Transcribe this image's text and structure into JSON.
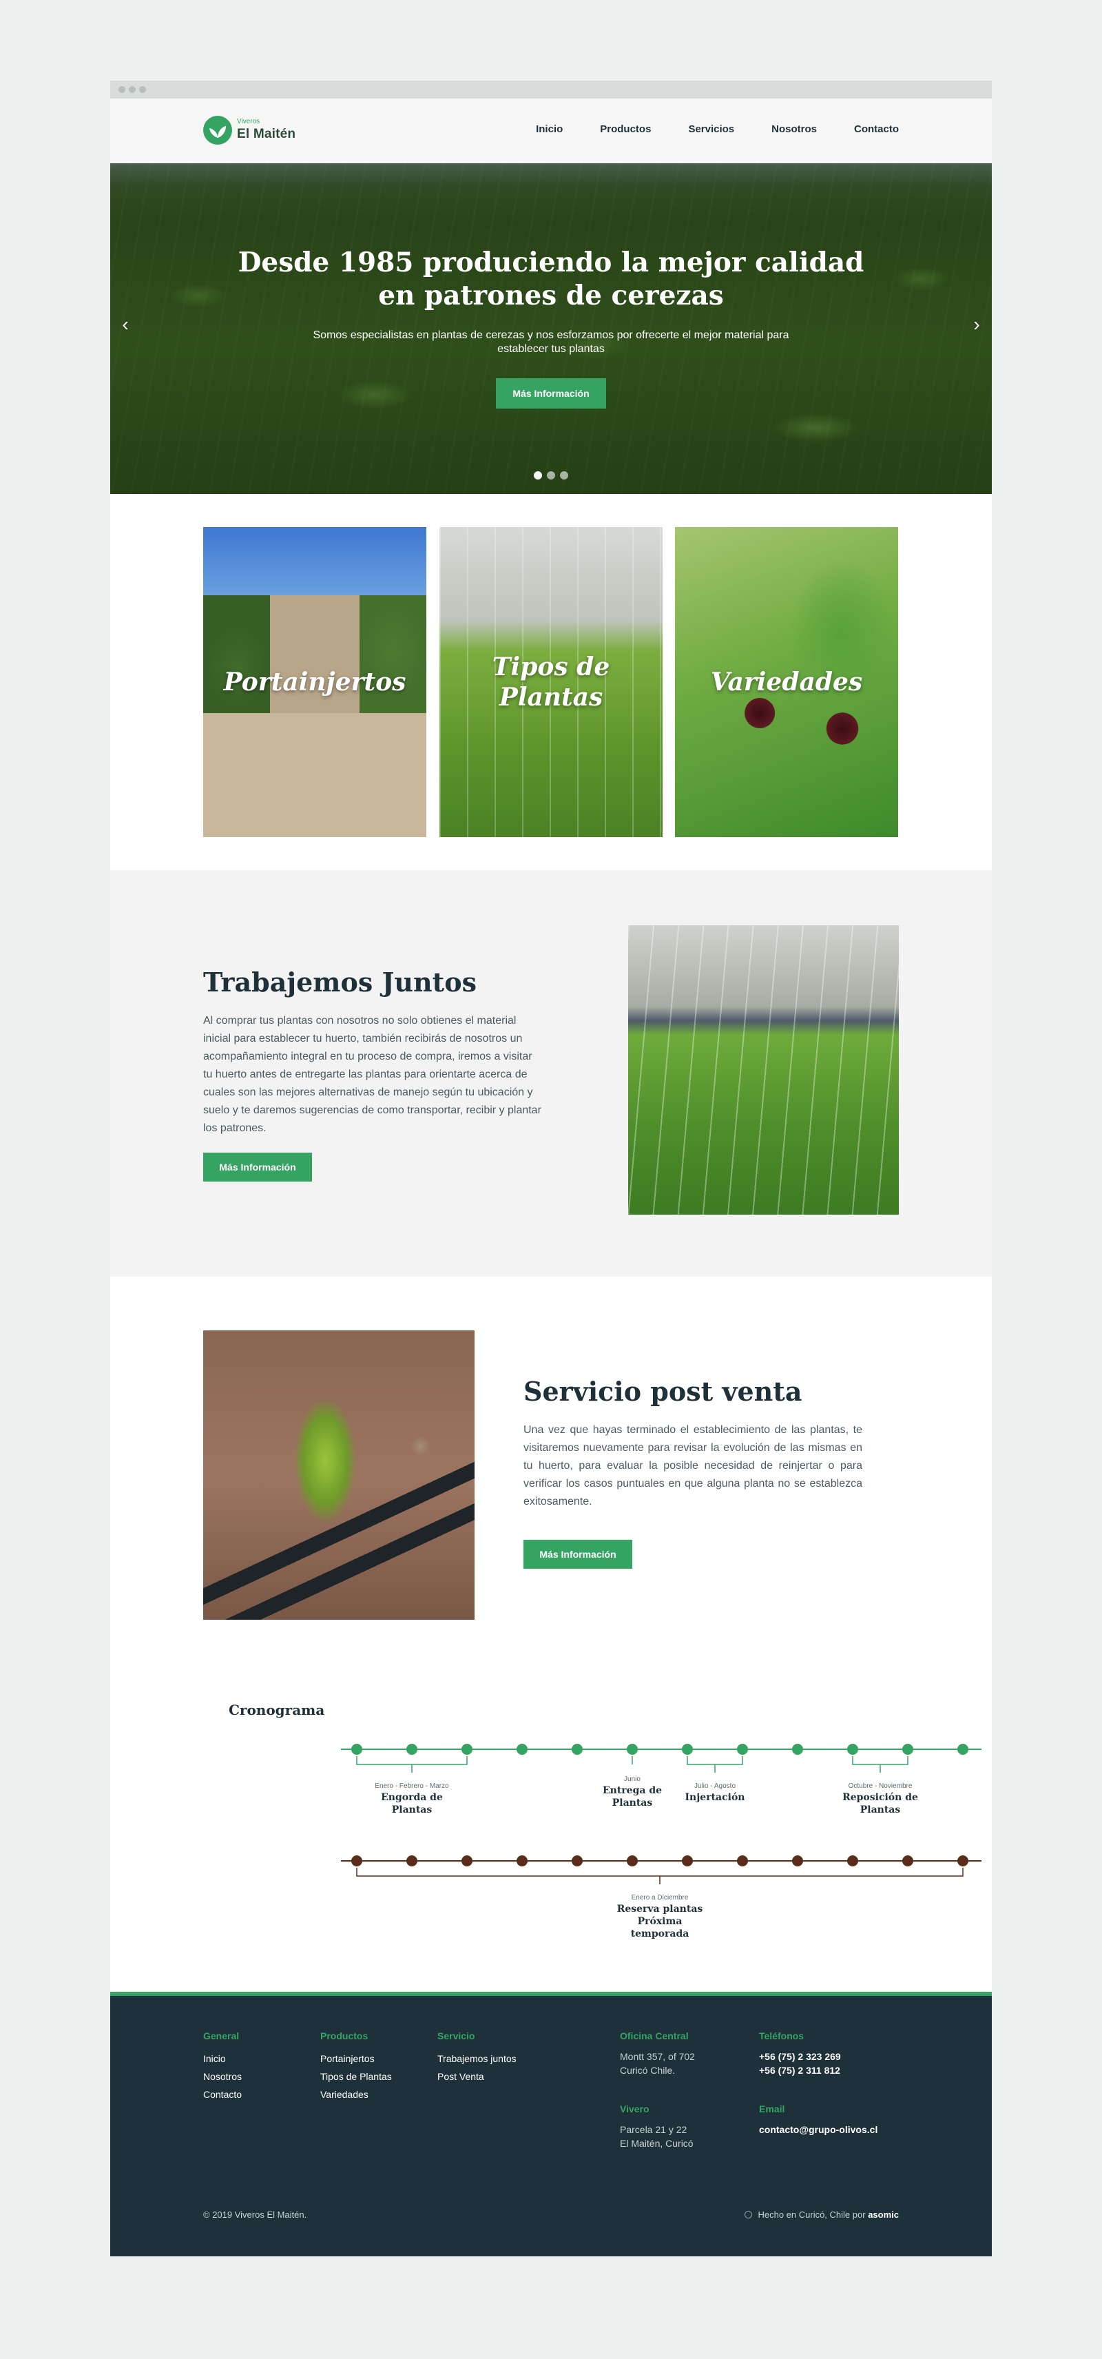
{
  "brand": {
    "small": "Viveros",
    "name": "El Maitén",
    "green": "#35a463",
    "dark": "#1e3039",
    "brown": "#5a2d1a"
  },
  "nav": [
    "Inicio",
    "Productos",
    "Servicios",
    "Nosotros",
    "Contacto"
  ],
  "hero": {
    "title_line1": "Desde 1985 produciendo la mejor calidad",
    "title_line2": "en patrones de cerezas",
    "subtitle": "Somos especialistas en plantas de cerezas y nos esforzamos por ofrecerte el mejor material para establecer tus plantas",
    "button": "Más Información",
    "prev_icon": "chevron-left-icon",
    "next_icon": "chevron-right-icon",
    "slides": 3,
    "active_slide": 1
  },
  "categories": [
    {
      "label": "Portainjertos"
    },
    {
      "label": "Tipos de Plantas"
    },
    {
      "label": "Variedades"
    }
  ],
  "trabajemos": {
    "title": "Trabajemos Juntos",
    "text": "Al comprar tus plantas con nosotros no solo obtienes el material inicial para establecer tu huerto, también recibirás de nosotros un acompañamiento integral en tu proceso de compra, iremos a visitar tu huerto antes de entregarte las plantas para orientarte acerca de cuales son las mejores alternativas de manejo según tu ubicación y suelo y te daremos sugerencias de como transportar, recibir y plantar los patrones.",
    "button": "Más Información"
  },
  "postventa": {
    "title": "Servicio post venta",
    "text": "Una vez que hayas terminado el establecimiento de las plantas, te visitaremos nuevamente para revisar la evolución de las mismas en tu huerto, para evaluar la posible necesidad de reinjertar o para verificar los casos puntuales en que alguna planta no se establezca exitosamente.",
    "button": "Más Información"
  },
  "cronograma": {
    "title": "Cronograma",
    "months": 12,
    "green_events": [
      {
        "period": "Enero - Febrero - Marzo",
        "title": "Engorda de Plantas",
        "start": 1,
        "end": 3
      },
      {
        "period": "Junio",
        "title": "Entrega de Plantas",
        "start": 6,
        "end": 6
      },
      {
        "period": "Julio - Agosto",
        "title": "Injertación",
        "start": 7,
        "end": 8
      },
      {
        "period": "Octubre - Noviembre",
        "title": "Reposición de Plantas",
        "start": 10,
        "end": 11
      }
    ],
    "brown_events": [
      {
        "period": "Enero a Diciembre",
        "title": "Reserva plantas Próxima temporada",
        "start": 1,
        "end": 12
      }
    ]
  },
  "footer": {
    "general": {
      "title": "General",
      "links": [
        "Inicio",
        "Nosotros",
        "Contacto"
      ]
    },
    "productos": {
      "title": "Productos",
      "links": [
        "Portainjertos",
        "Tipos de Plantas",
        "Variedades"
      ]
    },
    "servicio": {
      "title": "Servicio",
      "links": [
        "Trabajemos juntos",
        "Post Venta"
      ]
    },
    "oficina": {
      "title": "Oficina Central",
      "line1": "Montt 357, of 702",
      "line2": "Curicó Chile."
    },
    "vivero": {
      "title": "Vivero",
      "line1": "Parcela 21 y 22",
      "line2": "El Maitén, Curicó"
    },
    "telefonos": {
      "title": "Teléfonos",
      "line1": "+56 (75) 2 323 269",
      "line2": "+56 (75) 2 311 812"
    },
    "email": {
      "title": "Email",
      "value": "contacto@grupo-olivos.cl"
    },
    "copyright": "© 2019 Viveros El Maitén.",
    "made_in": "Hecho en Curicó, Chile por",
    "made_by": "asomic"
  }
}
